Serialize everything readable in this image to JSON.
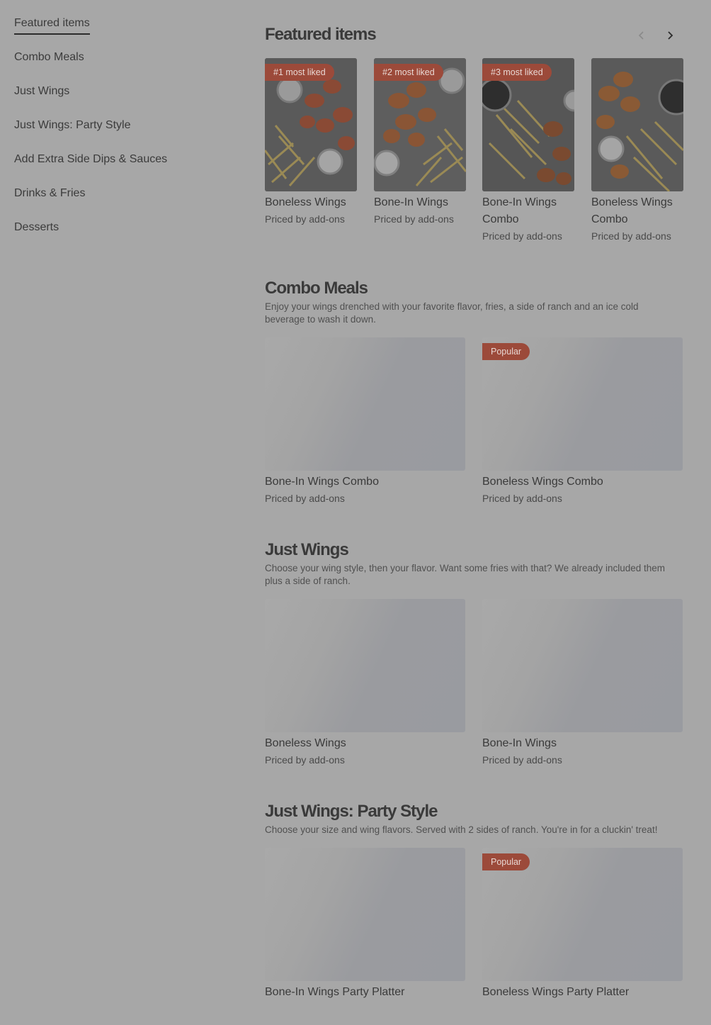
{
  "sidebar": {
    "items": [
      {
        "label": "Featured items",
        "active": true
      },
      {
        "label": "Combo Meals"
      },
      {
        "label": "Just Wings"
      },
      {
        "label": "Just Wings: Party Style"
      },
      {
        "label": "Add Extra Side Dips & Sauces"
      },
      {
        "label": "Drinks & Fries"
      },
      {
        "label": "Desserts"
      }
    ]
  },
  "featured": {
    "title": "Featured items",
    "prev_icon": "chevron-left-icon",
    "next_icon": "chevron-right-icon",
    "cards": [
      {
        "badge": "#1 most liked",
        "title": "Boneless Wings",
        "price": "Priced by add-ons"
      },
      {
        "badge": "#2 most liked",
        "title": "Bone-In Wings",
        "price": "Priced by add-ons"
      },
      {
        "badge": "#3 most liked",
        "title": "Bone-In Wings Combo",
        "price": "Priced by add-ons"
      },
      {
        "badge": "",
        "title": "Boneless Wings Combo",
        "price": "Priced by add-ons"
      }
    ]
  },
  "combo": {
    "title": "Combo Meals",
    "description": "Enjoy your wings drenched with your favorite flavor, fries, a side of ranch and an ice cold beverage to wash it down.",
    "cards": [
      {
        "badge": "",
        "title": "Bone-In Wings Combo",
        "price": "Priced by add-ons"
      },
      {
        "badge": "Popular",
        "title": "Boneless Wings Combo",
        "price": "Priced by add-ons"
      }
    ]
  },
  "just_wings": {
    "title": "Just Wings",
    "description": "Choose your wing style, then your flavor. Want some fries with that? We already included them plus a side of ranch.",
    "cards": [
      {
        "badge": "",
        "title": "Boneless Wings",
        "price": "Priced by add-ons"
      },
      {
        "badge": "",
        "title": "Bone-In Wings",
        "price": "Priced by add-ons"
      }
    ]
  },
  "party": {
    "title": "Just Wings: Party Style",
    "description": "Choose your size and wing flavors. Served with 2 sides of ranch. You're in for a cluckin' treat!",
    "cards": [
      {
        "badge": "",
        "title": "Bone-In Wings Party Platter",
        "price": ""
      },
      {
        "badge": "Popular",
        "title": "Boneless Wings Party Platter",
        "price": ""
      }
    ]
  },
  "colors": {
    "overlay_bg": "#a7a7a7",
    "badge_bg": "#9c4a3a",
    "text": "#3a3a3a"
  }
}
